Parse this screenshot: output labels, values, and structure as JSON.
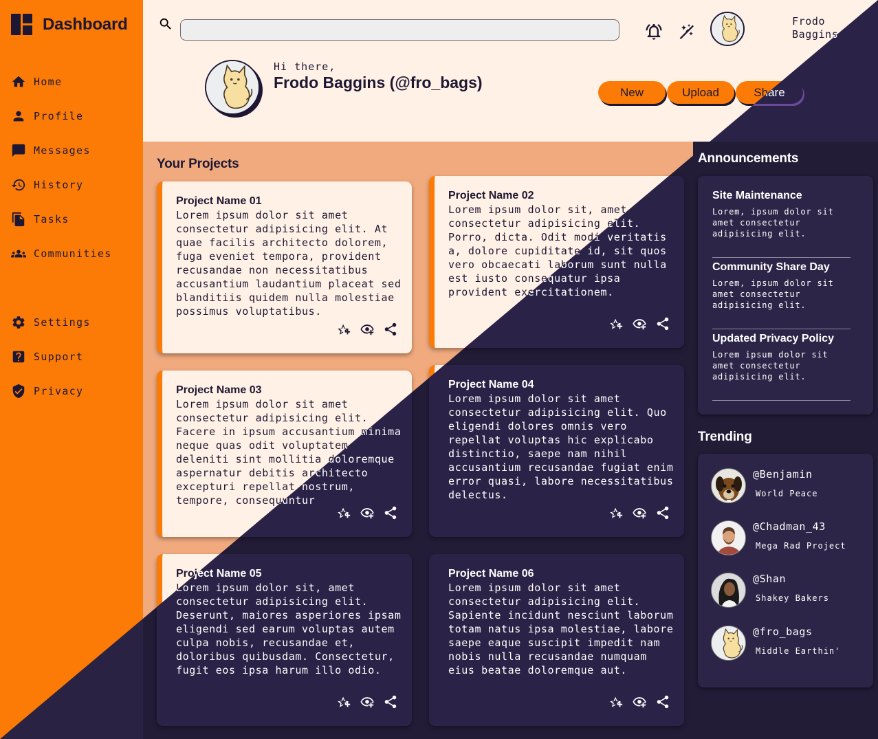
{
  "brand": {
    "title": "Dashboard"
  },
  "sidebar": {
    "items": [
      {
        "label": "Home",
        "icon": "home-icon"
      },
      {
        "label": "Profile",
        "icon": "person-icon"
      },
      {
        "label": "Messages",
        "icon": "chat-icon"
      },
      {
        "label": "History",
        "icon": "history-icon"
      },
      {
        "label": "Tasks",
        "icon": "documents-icon"
      },
      {
        "label": "Communities",
        "icon": "group-icon"
      }
    ],
    "bottom_items": [
      {
        "label": "Settings",
        "icon": "gear-icon"
      },
      {
        "label": "Support",
        "icon": "help-icon"
      },
      {
        "label": "Privacy",
        "icon": "shield-icon"
      }
    ]
  },
  "header": {
    "search": {
      "value": "",
      "placeholder": ""
    },
    "user_first": "Frodo",
    "user_last": "Baggins",
    "greeting": "Hi there,",
    "display_name": "Frodo Baggins (@fro_bags)",
    "buttons": {
      "new": "New",
      "upload": "Upload",
      "share": "Share"
    }
  },
  "projects": {
    "title": "Your Projects",
    "cards": [
      {
        "title": "Project Name 01",
        "body": "Lorem ipsum dolor sit amet consectetur adipisicing elit. At quae facilis architecto dolorem, fuga eveniet tempora, provident recusandae non necessitatibus accusantium laudantium placeat sed blanditiis quidem nulla molestiae possimus voluptatibus."
      },
      {
        "title": "Project Name 02",
        "body": "Lorem ipsum dolor sit, amet consectetur adipisicing elit. Porro, dicta. Odit modi veritatis a, dolore cupiditate id, sit quos vero obcaecati laborum sunt nulla est iusto consequatur ipsa provident exercitationem."
      },
      {
        "title": "Project Name 03",
        "body": "Lorem ipsum dolor sit amet consectetur adipisicing elit. Facere in ipsum accusantium minima neque quas odit voluptatem deleniti sint mollitia doloremque aspernatur debitis architecto excepturi repellat nostrum, tempore, consequuntur"
      },
      {
        "title": "Project Name 04",
        "body": "Lorem ipsum dolor sit amet consectetur adipisicing elit. Quo eligendi dolores omnis vero repellat voluptas hic explicabo distinctio, saepe nam nihil accusantium recusandae fugiat enim error quasi, labore necessitatibus delectus."
      },
      {
        "title": "Project Name 05",
        "body": "Lorem ipsum dolor sit, amet consectetur adipisicing elit. Deserunt, maiores asperiores ipsam eligendi sed earum voluptas autem culpa nobis, recusandae et, doloribus quibusdam. Consectetur, fugit eos ipsa harum illo odio."
      },
      {
        "title": "Project Name 06",
        "body": "Lorem ipsum dolor sit amet consectetur adipisicing elit. Sapiente incidunt nesciunt laborum totam natus ipsa molestiae, labore saepe eaque suscipit impedit nam nobis nulla recusandae numquam eius beatae doloremque aut."
      }
    ],
    "card_icons": [
      "star-add-icon",
      "watch-icon",
      "share-icon"
    ]
  },
  "announcements": {
    "title": "Announcements",
    "items": [
      {
        "title": "Site Maintenance",
        "text": "Lorem, ipsum dolor sit amet consectetur adipisicing elit."
      },
      {
        "title": "Community Share Day",
        "text": "Lorem, ipsum dolor sit amet consectetur adipisicing elit."
      },
      {
        "title": "Updated Privacy Policy",
        "text": "Lorem ipsum dolor sit amet consectetur adipisicing elit."
      }
    ]
  },
  "trending": {
    "title": "Trending",
    "items": [
      {
        "handle": "@Benjamin",
        "desc": "World Peace",
        "avatar": "dog-avatar"
      },
      {
        "handle": "@Chadman_43",
        "desc": "Mega Rad Project",
        "avatar": "man-avatar"
      },
      {
        "handle": "@Shan",
        "desc": "Shakey Bakers",
        "avatar": "woman-avatar"
      },
      {
        "handle": "@fro_bags",
        "desc": "Middle Earthin'",
        "avatar": "cat-avatar"
      }
    ]
  },
  "colors": {
    "accent": "#fb7b06",
    "dark": "#221c37",
    "card_light": "#fff1e5",
    "main_light": "#f1aa7e",
    "card_dark": "#2c2547"
  }
}
